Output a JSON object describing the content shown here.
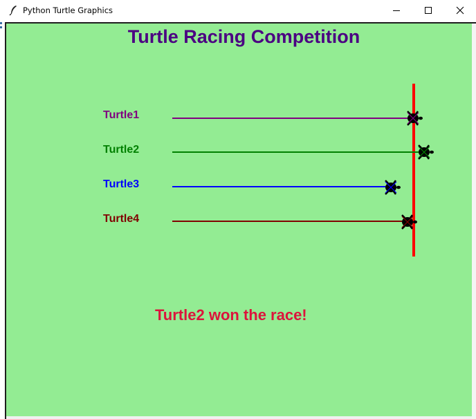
{
  "window": {
    "title": "Python Turtle Graphics",
    "icon": "feather-icon",
    "controls": [
      "minimize-icon",
      "maximize-icon",
      "close-icon"
    ]
  },
  "canvas": {
    "background": "#93ec93",
    "title": "Turtle Racing Competition",
    "title_color": "#4b0082",
    "finish_line_color": "#ff0000",
    "turtles": [
      {
        "label": "Turtle1",
        "color": "#800080"
      },
      {
        "label": "Turtle2",
        "color": "#008000"
      },
      {
        "label": "Turtle3",
        "color": "#0000ff"
      },
      {
        "label": "Turtle4",
        "color": "#800000"
      }
    ],
    "result": "Turtle2 won the race!",
    "result_color": "#dc143c"
  }
}
